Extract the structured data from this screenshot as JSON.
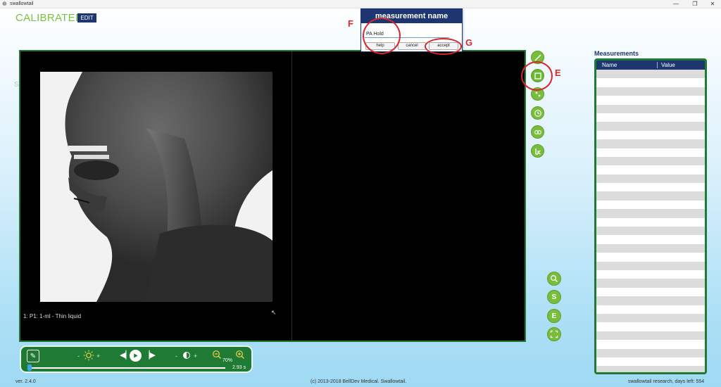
{
  "window": {
    "title": "swallowtail",
    "minimize_glyph": "—",
    "maximize_glyph": "❐",
    "close_glyph": "✕"
  },
  "header": {
    "status": "CALIBRATED",
    "edit_label": "EDIT",
    "stray_letter": "S"
  },
  "viewer": {
    "video_label": "1: P1: 1-ml - Thin liquid"
  },
  "tools": [
    {
      "name": "line-tool",
      "icon": "line-icon"
    },
    {
      "name": "area-tool",
      "icon": "square-icon"
    },
    {
      "name": "point-tool",
      "icon": "points-icon"
    },
    {
      "name": "timer-tool",
      "icon": "clock-icon"
    },
    {
      "name": "link-tool",
      "icon": "link-icon"
    },
    {
      "name": "lk-tool",
      "icon": "lk-icon"
    }
  ],
  "dialog": {
    "title": "measurement name",
    "input_value": "PA Hold",
    "help_label": "help",
    "cancel_label": "cancel",
    "accept_label": "accept"
  },
  "annotations": {
    "f": "F",
    "g": "G",
    "e": "E"
  },
  "measurements": {
    "title": "Measurements",
    "col_name": "Name",
    "col_value": "Value",
    "rows": 35
  },
  "side_buttons": {
    "search": "search-icon",
    "s_label": "S",
    "e_label": "E",
    "fit": "fit-screen-icon"
  },
  "playback": {
    "minus": "-",
    "plus": "+",
    "zoom_value": "70%",
    "time": "2.93 s",
    "progress": 0.01
  },
  "footer": {
    "version": "ver. 2.4.0",
    "copyright": "(c) 2013-2018 BellDev Medical.  Swallowtail.",
    "license": "swallowtail research, days left: 554"
  },
  "colors": {
    "accent_green": "#78bd3b",
    "dark_green": "#1f7a34",
    "navy": "#1d3670",
    "annotation_red": "#d9262a"
  }
}
